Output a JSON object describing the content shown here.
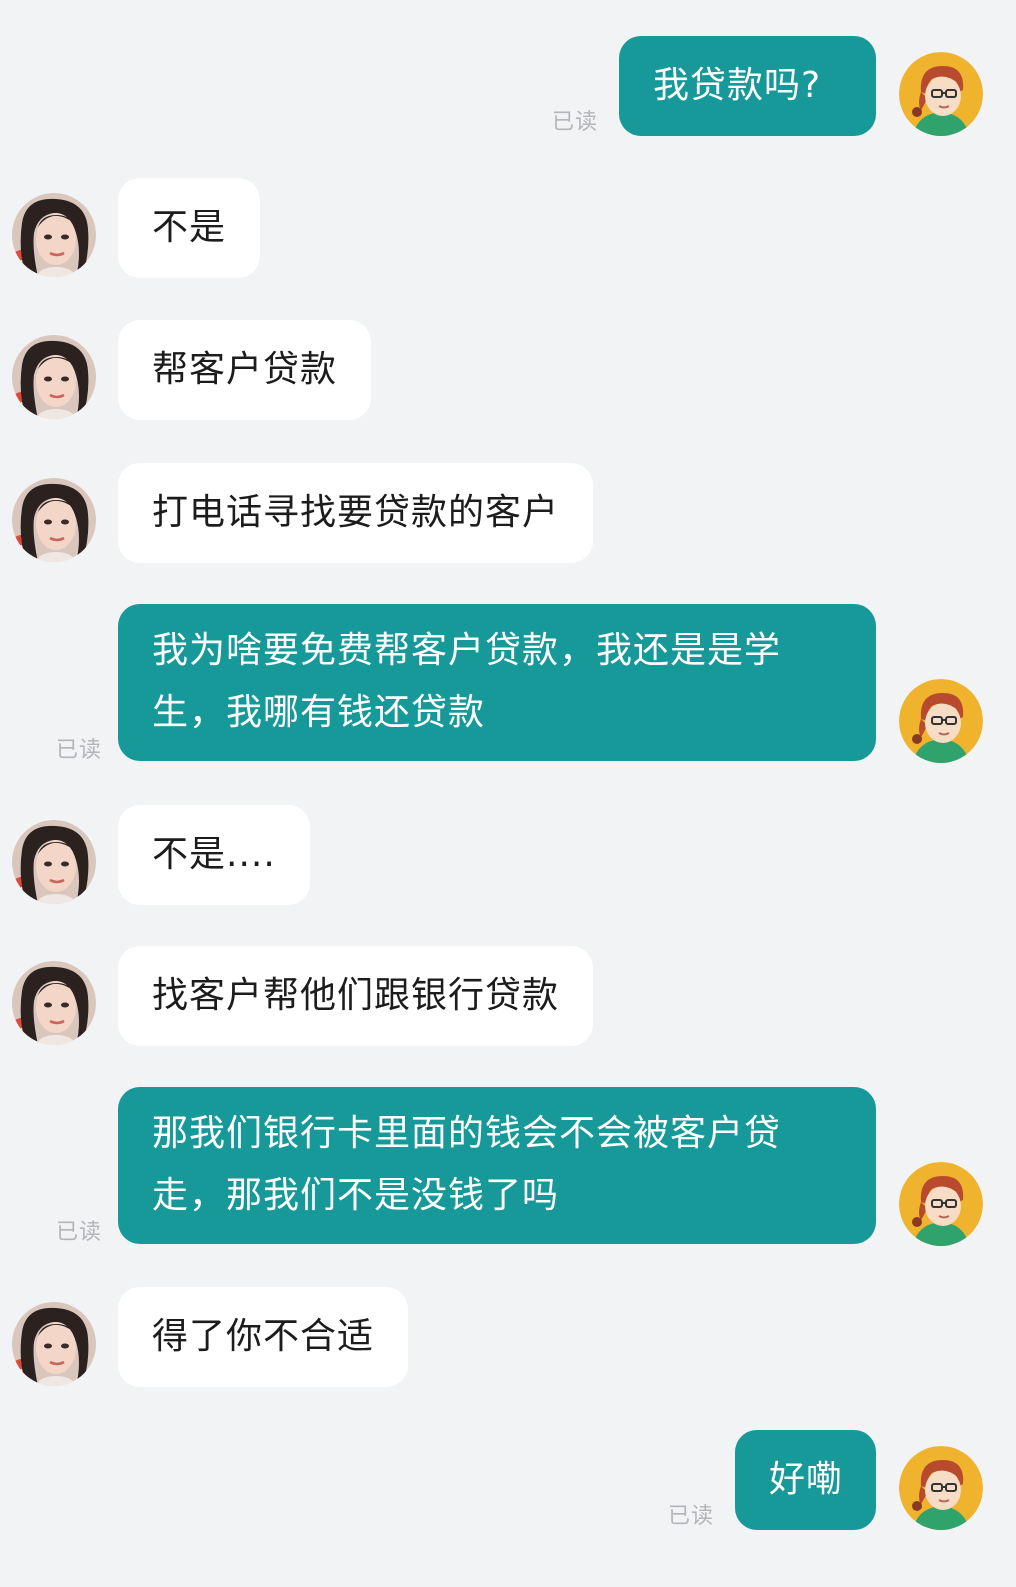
{
  "read_label": "已读",
  "messages": [
    {
      "sender": "me",
      "text": "我贷款吗?",
      "read": true
    },
    {
      "sender": "other",
      "text": "不是"
    },
    {
      "sender": "other",
      "text": "帮客户贷款"
    },
    {
      "sender": "other",
      "text": "打电话寻找要贷款的客户"
    },
    {
      "sender": "me",
      "text": "我为啥要免费帮客户贷款，我还是是学生，我哪有钱还贷款",
      "read": true
    },
    {
      "sender": "other",
      "text": "不是...."
    },
    {
      "sender": "other",
      "text": "找客户帮他们跟银行贷款"
    },
    {
      "sender": "me",
      "text": "那我们银行卡里面的钱会不会被客户贷走，那我们不是没钱了吗",
      "read": true
    },
    {
      "sender": "other",
      "text": "得了你不合适"
    },
    {
      "sender": "me",
      "text": "好嘞",
      "read": true
    }
  ],
  "colors": {
    "background": "#f2f3f5",
    "my_bubble": "#17999a",
    "their_bubble": "#ffffff",
    "read_text": "#b3b5b9"
  },
  "icons": {
    "my_avatar": "cartoon-avatar-glasses-icon",
    "their_avatar": "contact-photo-avatar"
  }
}
